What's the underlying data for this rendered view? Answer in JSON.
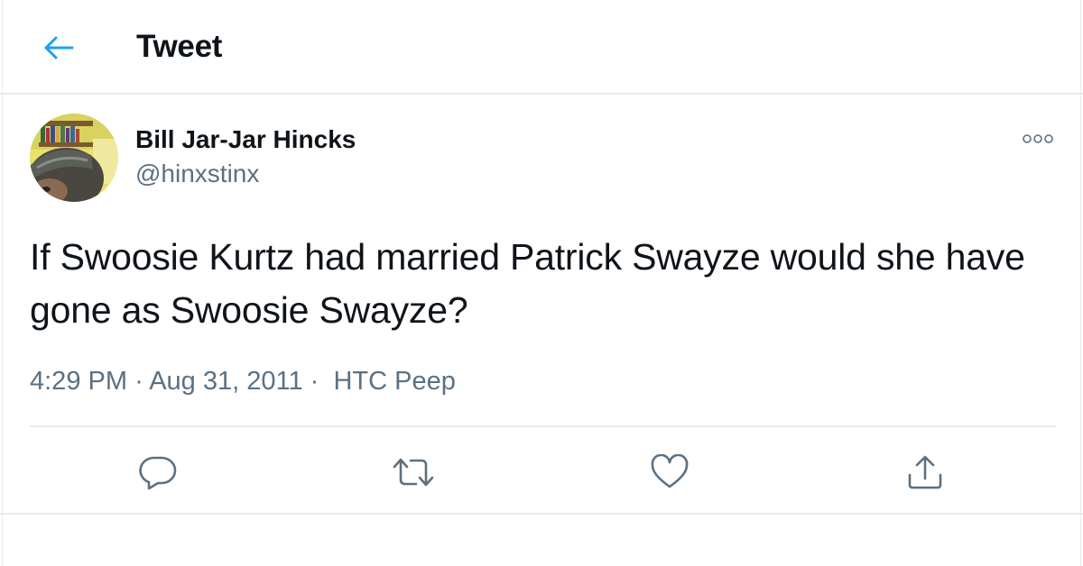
{
  "header": {
    "title": "Tweet",
    "back_icon": "arrow-left-icon",
    "accent_color": "#1da1f2"
  },
  "tweet": {
    "author_name": "Bill Jar-Jar Hincks",
    "author_handle": "@hinxstinx",
    "text": "If Swoosie Kurtz had married Patrick Swayze would she have gone as Swoosie Swayze?",
    "time": "4:29 PM",
    "separator": "·",
    "date": "Aug 31, 2011",
    "source": "HTC Peep",
    "more_icon": "more-options-icon"
  },
  "actions": [
    {
      "name": "reply",
      "icon": "reply-icon"
    },
    {
      "name": "retweet",
      "icon": "retweet-icon"
    },
    {
      "name": "like",
      "icon": "heart-icon"
    },
    {
      "name": "share",
      "icon": "share-icon"
    }
  ],
  "colors": {
    "text_primary": "#0f1419",
    "text_secondary": "#5b7083",
    "border": "#e6ecf0",
    "icon": "#5b7083"
  }
}
